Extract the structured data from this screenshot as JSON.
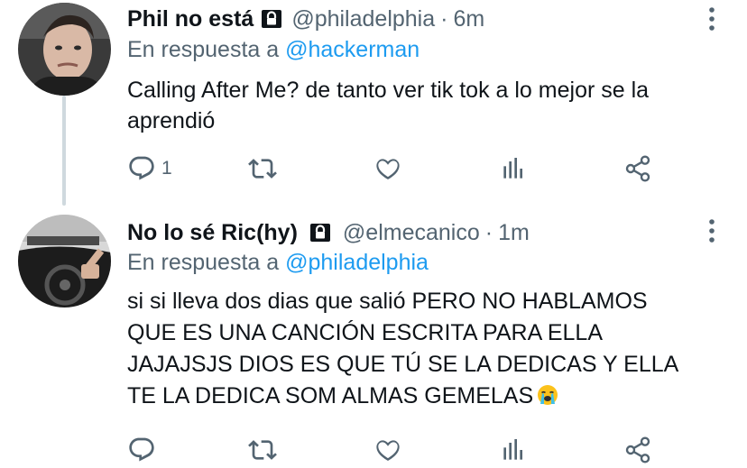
{
  "tweets": [
    {
      "display_name": "Phil no está",
      "handle": "@philadelphia",
      "separator": "·",
      "time": "6m",
      "reply_prefix": "En respuesta a",
      "reply_to": "@hackerman",
      "text_lines": [
        "Calling After Me? de tanto ver tik tok a lo mejor se la",
        "aprendió"
      ],
      "reply_count": "1",
      "icons": [
        "lock-icon",
        "more-icon",
        "reply-icon",
        "retweet-icon",
        "like-icon",
        "stats-icon",
        "share-icon"
      ]
    },
    {
      "display_name": "No lo sé Ric(hy)",
      "handle": "@elmecanico",
      "separator": "·",
      "time": "1m",
      "reply_prefix": "En respuesta a",
      "reply_to": "@philadelphia",
      "text_lines": [
        "si si lleva dos dias que salió PERO NO HABLAMOS",
        "QUE ES UNA CANCIÓN ESCRITA PARA ELLA",
        "JAJAJSJS DIOS ES QUE TÚ SE LA DEDICAS Y ELLA",
        "TE LA DEDICA SOM ALMAS GEMELAS"
      ],
      "emoji": "loudly-crying-face",
      "reply_count": "",
      "icons": [
        "lock-icon",
        "more-icon",
        "reply-icon",
        "retweet-icon",
        "like-icon",
        "stats-icon",
        "share-icon"
      ]
    }
  ],
  "colors": {
    "text": "#0f1419",
    "secondary": "#536471",
    "mention": "#1d9bf0",
    "thread_line": "#cfd9de"
  }
}
